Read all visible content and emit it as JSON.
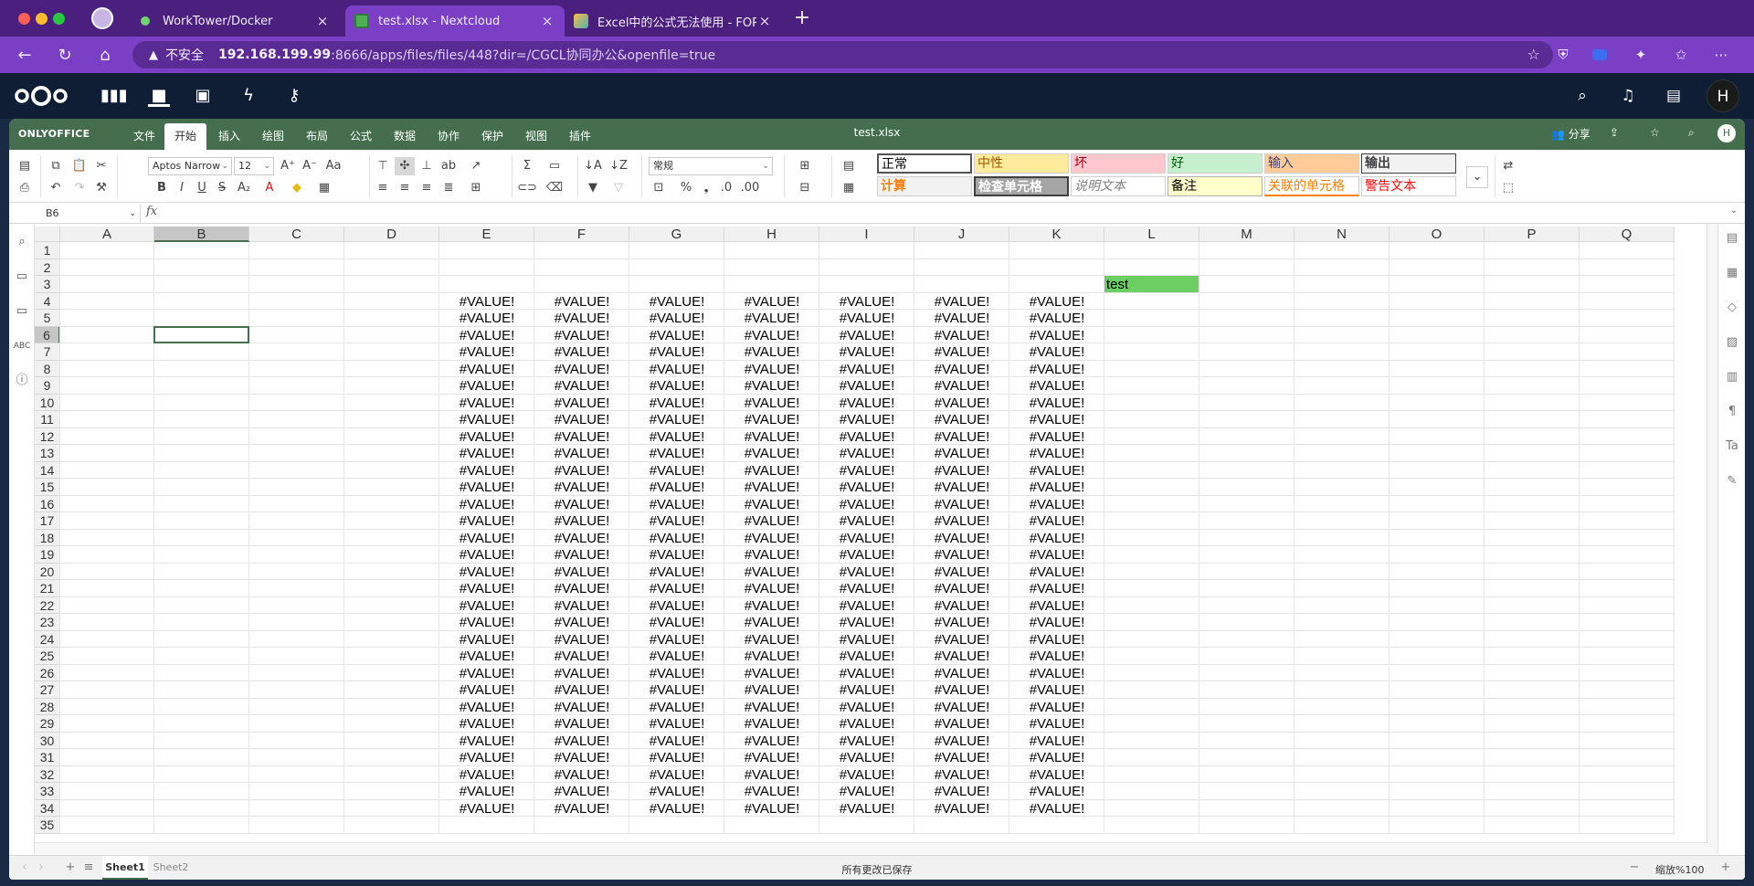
{
  "browser": {
    "tabs": [
      {
        "title": "WorkTower/Docker",
        "active": false
      },
      {
        "title": "test.xlsx - Nextcloud",
        "active": true
      },
      {
        "title": "Excel中的公式无法使用 - FORMS",
        "active": false
      }
    ],
    "not_secure_label": "不安全",
    "url_host": "192.168.199.99",
    "url_path": ":8666/apps/files/files/448?dir=/CGCL协同办公&openfile=true"
  },
  "nextcloud": {
    "avatar_initial": "H"
  },
  "onlyoffice": {
    "brand": "ONLYOFFICE",
    "menu": [
      "文件",
      "开始",
      "插入",
      "绘图",
      "布局",
      "公式",
      "数据",
      "协作",
      "保护",
      "视图",
      "插件"
    ],
    "active_menu": "开始",
    "filename": "test.xlsx",
    "share_label": "分享",
    "user_initial": "H",
    "font_name": "Aptos Narrow",
    "font_size": "12",
    "number_format": "常规",
    "cell_styles": [
      {
        "label": "正常",
        "bg": "#ffffff",
        "fg": "#000000"
      },
      {
        "label": "中性",
        "bg": "#ffeb9c",
        "fg": "#9c5700"
      },
      {
        "label": "坏",
        "bg": "#ffc7ce",
        "fg": "#9c0006"
      },
      {
        "label": "好",
        "bg": "#c6efce",
        "fg": "#006100"
      },
      {
        "label": "输入",
        "bg": "#ffcc99",
        "fg": "#3f3f76"
      },
      {
        "label": "输出",
        "bg": "#f2f2f2",
        "fg": "#3f3f3f"
      },
      {
        "label": "计算",
        "bg": "#f2f2f2",
        "fg": "#fa7d00"
      },
      {
        "label": "检查单元格",
        "bg": "#a5a5a5",
        "fg": "#ffffff"
      },
      {
        "label": "说明文本",
        "bg": "#ffffff",
        "fg": "#7f7f7f"
      },
      {
        "label": "备注",
        "bg": "#ffffcc",
        "fg": "#000000"
      },
      {
        "label": "关联的单元格",
        "bg": "#ffffff",
        "fg": "#fa7d00"
      },
      {
        "label": "警告文本",
        "bg": "#ffffff",
        "fg": "#ff0000"
      }
    ],
    "name_box": "B6",
    "fx_label": "fx"
  },
  "sheet": {
    "columns": [
      "A",
      "B",
      "C",
      "D",
      "E",
      "F",
      "G",
      "H",
      "I",
      "J",
      "K",
      "L",
      "M",
      "N",
      "O",
      "P",
      "Q"
    ],
    "selected_column": "B",
    "selected_row": 6,
    "row_count": 35,
    "error_value": "#VALUE!",
    "error_columns": [
      "E",
      "F",
      "G",
      "H",
      "I",
      "J",
      "K"
    ],
    "error_rows_from": 4,
    "error_rows_to": 34,
    "highlight_cell": {
      "col": "L",
      "row": 3,
      "text": "test",
      "bg": "#6ccf62"
    }
  },
  "statusbar": {
    "sheets": [
      "Sheet1",
      "Sheet2"
    ],
    "active_sheet": "Sheet1",
    "save_status": "所有更改已保存",
    "zoom_label": "缩放%100"
  }
}
